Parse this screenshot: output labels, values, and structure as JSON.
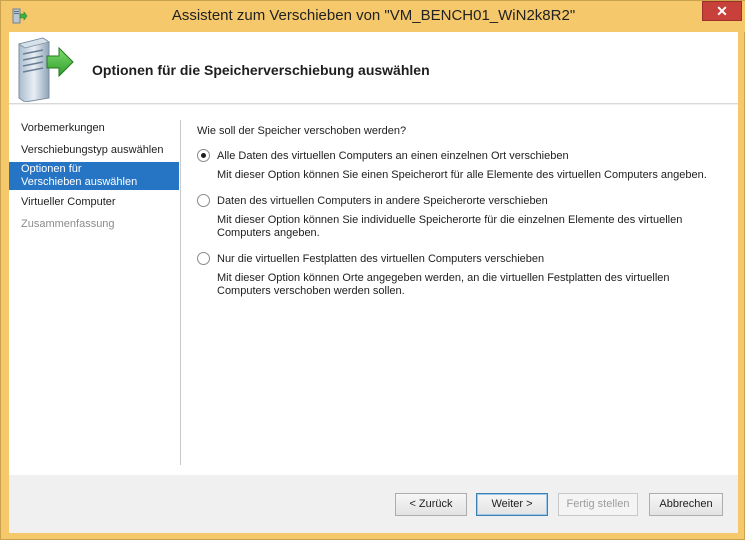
{
  "window": {
    "title": "Assistent zum Verschieben von \"VM_BENCH01_WiN2k8R2\"",
    "close_label": "✕"
  },
  "header": {
    "title": "Optionen für die Speicherverschiebung auswählen"
  },
  "nav": {
    "items": [
      {
        "label": "Vorbemerkungen",
        "state": "normal"
      },
      {
        "label": "Verschiebungstyp auswählen",
        "state": "normal"
      },
      {
        "label": "Optionen für Verschieben auswählen",
        "state": "selected"
      },
      {
        "label": "Virtueller Computer",
        "state": "normal"
      },
      {
        "label": "Zusammenfassung",
        "state": "disabled"
      }
    ]
  },
  "content": {
    "question": "Wie soll der Speicher verschoben werden?",
    "options": [
      {
        "label": "Alle Daten des virtuellen Computers an einen einzelnen Ort verschieben",
        "description": "Mit dieser Option können Sie einen Speicherort für alle Elemente des virtuellen Computers angeben.",
        "checked": true
      },
      {
        "label": "Daten des virtuellen Computers in andere Speicherorte verschieben",
        "description": "Mit dieser Option können Sie individuelle Speicherorte für die einzelnen Elemente des virtuellen Computers angeben.",
        "checked": false
      },
      {
        "label": "Nur die virtuellen Festplatten des virtuellen Computers verschieben",
        "description": "Mit dieser Option können Orte angegeben werden, an die virtuellen Festplatten des virtuellen Computers verschoben werden sollen.",
        "checked": false
      }
    ]
  },
  "footer": {
    "back": "< Zurück",
    "next": "Weiter >",
    "finish": "Fertig stellen",
    "cancel": "Abbrechen"
  },
  "colors": {
    "titlebar": "#f5c96b",
    "selection": "#2675c5",
    "close": "#c7403a"
  }
}
